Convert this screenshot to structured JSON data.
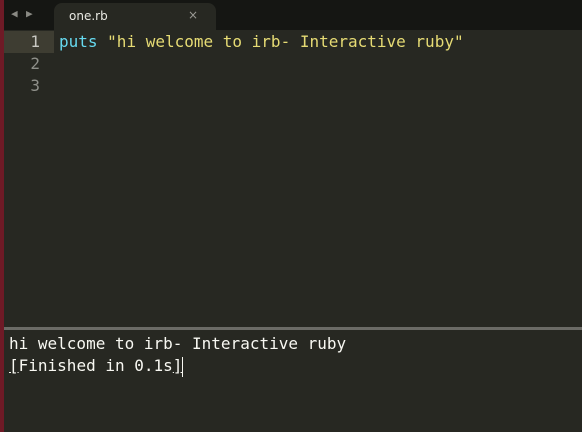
{
  "tab": {
    "label": "one.rb",
    "close": "×"
  },
  "nav": {
    "back": "◀",
    "forward": "▶"
  },
  "editor": {
    "lines": [
      {
        "number": "1",
        "keyword": "puts",
        "string": "\"hi welcome to irb- Interactive ruby\""
      },
      {
        "number": "2"
      },
      {
        "number": "3"
      }
    ]
  },
  "output": {
    "line1": "hi welcome to irb- Interactive ruby",
    "line2_open": "[",
    "line2_body": "Finished in 0.1s",
    "line2_close": "]"
  },
  "colors": {
    "keyword": "#66d9ef",
    "string": "#e6db74",
    "background": "#272822"
  }
}
